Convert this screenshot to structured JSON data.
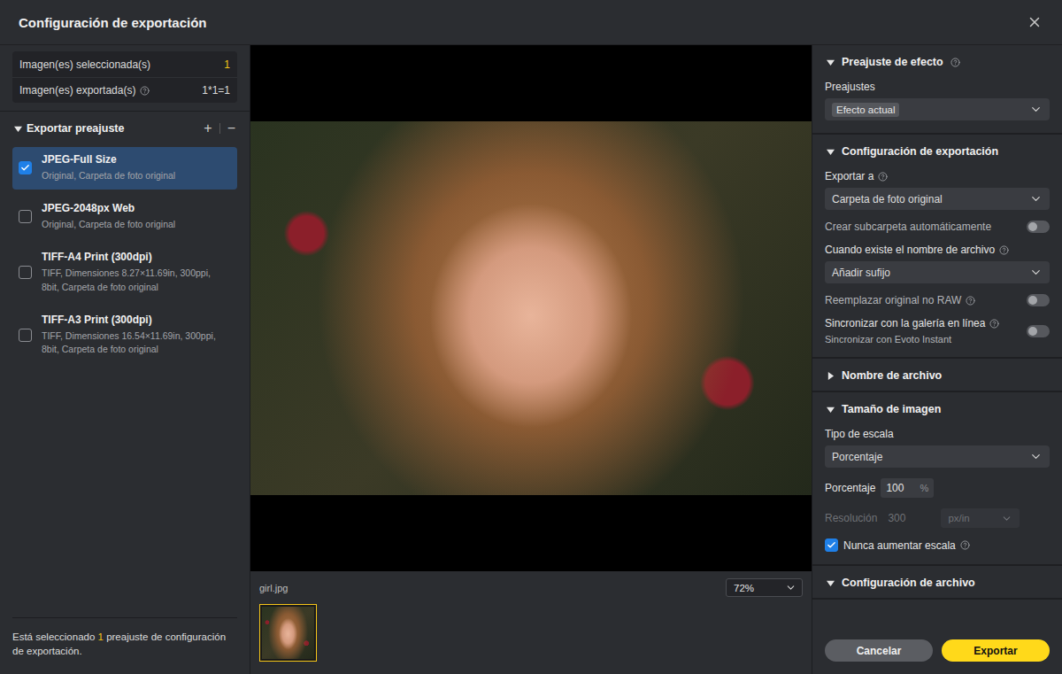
{
  "window": {
    "title": "Configuración de exportación"
  },
  "summary": [
    {
      "label": "Imagen(es) seleccionada(s)",
      "value": "1",
      "info": false,
      "highlight": true
    },
    {
      "label": "Imagen(es) exportada(s)",
      "value": "1*1=1",
      "info": true,
      "highlight": false
    }
  ],
  "presets": {
    "title": "Exportar preajuste",
    "expanded": true,
    "add": "+",
    "remove": "−",
    "items": [
      {
        "name": "JPEG-Full Size",
        "details": "Original, Carpeta de foto original",
        "checked": true,
        "selected": true
      },
      {
        "name": "JPEG-2048px Web",
        "details": "Original, Carpeta de foto original",
        "checked": false,
        "selected": false
      },
      {
        "name": "TIFF-A4 Print (300dpi)",
        "details": "TIFF, Dimensiones 8.27×11.69in, 300ppi, 8bit, Carpeta de foto original",
        "checked": false,
        "selected": false
      },
      {
        "name": "TIFF-A3 Print (300dpi)",
        "details": "TIFF, Dimensiones 16.54×11.69in, 300ppi, 8bit, Carpeta de foto original",
        "checked": false,
        "selected": false
      }
    ]
  },
  "footer_note": {
    "before": "Está seleccionado ",
    "count": "1",
    "after": " preajuste de configuración de exportación."
  },
  "preview": {
    "file_name": "girl.jpg",
    "zoom": "72%",
    "thumbnails": [
      {
        "selected": true
      }
    ]
  },
  "sections": [
    {
      "title": "Preajuste de efecto",
      "info": true,
      "expanded": true,
      "fields": [
        {
          "kind": "select-tag",
          "label": "Preajustes",
          "info": false,
          "value": "Efecto actual"
        }
      ]
    },
    {
      "title": "Configuración de exportación",
      "info": false,
      "expanded": true,
      "fields": [
        {
          "kind": "select",
          "label": "Exportar a",
          "info": true,
          "value": "Carpeta de foto original"
        },
        {
          "kind": "toggle",
          "label": "Crear subcarpeta automáticamente",
          "info": false,
          "on": false
        },
        {
          "kind": "select",
          "label": "Cuando existe el nombre de archivo",
          "info": true,
          "value": "Añadir sufijo"
        },
        {
          "kind": "toggle",
          "label": "Reemplazar original no RAW",
          "info": true,
          "on": false
        },
        {
          "kind": "toggle",
          "label": "Sincronizar con la galería en línea",
          "sublabel": "Sincronizar con Evoto Instant",
          "info": true,
          "on": false
        }
      ]
    },
    {
      "title": "Nombre de archivo",
      "info": false,
      "expanded": false,
      "fields": []
    },
    {
      "title": "Tamaño de imagen",
      "info": false,
      "expanded": true,
      "fields": [
        {
          "kind": "select",
          "label": "Tipo de escala",
          "info": false,
          "value": "Porcentaje"
        },
        {
          "kind": "number",
          "label": "Porcentaje",
          "info": false,
          "value": "100",
          "unit": "%",
          "disabled": false
        },
        {
          "kind": "number-select",
          "label": "Resolución",
          "info": false,
          "value": "300",
          "unit": "px/in",
          "disabled": true
        },
        {
          "kind": "checkbox",
          "label": "Nunca aumentar escala",
          "info": true,
          "checked": true
        }
      ]
    },
    {
      "title": "Configuración de archivo",
      "info": false,
      "expanded": true,
      "fields": []
    }
  ],
  "buttons": [
    {
      "label": "Cancelar",
      "kind": "secondary"
    },
    {
      "label": "Exportar",
      "kind": "primary"
    }
  ]
}
